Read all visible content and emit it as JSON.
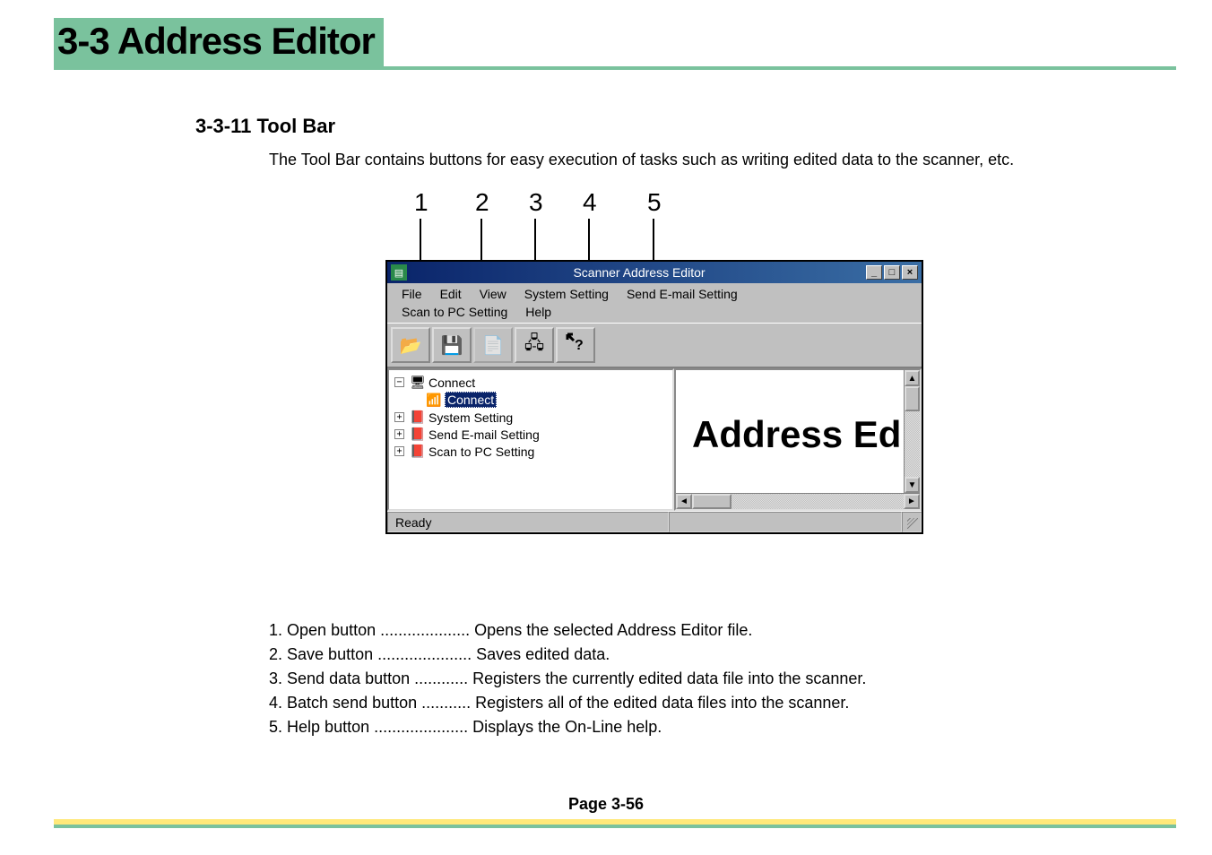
{
  "header": {
    "title": "3-3  Address Editor"
  },
  "section": {
    "number_title": "3-3-11  Tool Bar",
    "intro": "The Tool Bar contains buttons for easy execution of tasks such as writing edited data to the scanner, etc."
  },
  "callouts": [
    "1",
    "2",
    "3",
    "4",
    "5"
  ],
  "window": {
    "title": "Scanner Address Editor",
    "window_controls": {
      "minimize": "_",
      "maximize": "□",
      "close": "×"
    },
    "menu": [
      "File",
      "Edit",
      "View",
      "System Setting",
      "Send E-mail Setting",
      "Scan to PC Setting",
      "Help"
    ],
    "toolbar_icons": {
      "open": "📂",
      "save": "💾",
      "send": "📄",
      "batch": "🖧",
      "help": "⁇"
    },
    "tree": {
      "root": "Connect",
      "selected_child": "Connect",
      "items": [
        "System Setting",
        "Send E-mail Setting",
        "Scan to PC Setting"
      ]
    },
    "right_pane_text": "Address Ed",
    "status": "Ready"
  },
  "legend": [
    {
      "n": "1",
      "name": "Open button",
      "dots": " .................... ",
      "desc": "Opens the selected Address Editor file."
    },
    {
      "n": "2",
      "name": "Save button",
      "dots": " ..................... ",
      "desc": "Saves edited data."
    },
    {
      "n": "3",
      "name": "Send data button",
      "dots": " ............ ",
      "desc": "Registers the currently edited data file into the scanner."
    },
    {
      "n": "4",
      "name": "Batch send button",
      "dots": " ........... ",
      "desc": "Registers all of the edited data files into the scanner."
    },
    {
      "n": "5",
      "name": "Help button",
      "dots": " ..................... ",
      "desc": "Displays the On-Line help."
    }
  ],
  "footer": {
    "page": "Page 3-56"
  }
}
